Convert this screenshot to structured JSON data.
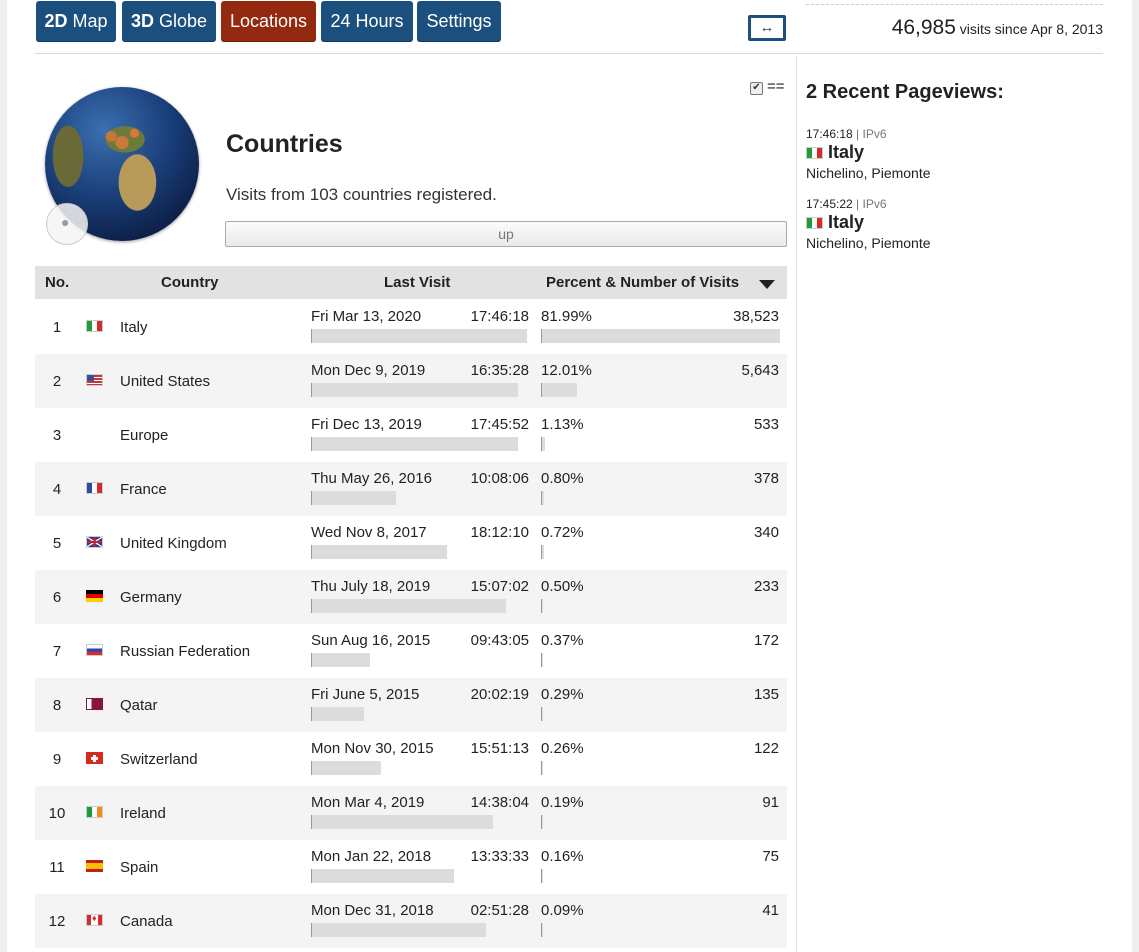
{
  "tabs": [
    {
      "label_bold": "2D",
      "label": " Map",
      "active": false
    },
    {
      "label_bold": "3D",
      "label": " Globe",
      "active": false
    },
    {
      "label_bold": "",
      "label": "Locations",
      "active": true
    },
    {
      "label_bold": "",
      "label": "24 Hours",
      "active": false
    },
    {
      "label_bold": "",
      "label": "Settings",
      "active": false
    }
  ],
  "toggle_icon": "↔",
  "visits_summary": {
    "count": "46,985",
    "text": " visits since Apr 8, 2013"
  },
  "countries_panel": {
    "title": "Countries",
    "subtitle": "Visits from 103 countries registered.",
    "up_label": "up",
    "options_check": "✔",
    "options_equals": "=="
  },
  "table": {
    "headers": {
      "no": "No.",
      "country": "Country",
      "last_visit": "Last Visit",
      "visits": "Percent & Number of Visits"
    },
    "rows": [
      {
        "no": "1",
        "flag": "it",
        "country": "Italy",
        "date": "Fri Mar 13, 2020",
        "time": "17:46:18",
        "last_visit_recency": 1.0,
        "percent": "81.99%",
        "count": "38,523",
        "share": 0.8199
      },
      {
        "no": "2",
        "flag": "us",
        "country": "United States",
        "date": "Mon Dec 9, 2019",
        "time": "16:35:28",
        "last_visit_recency": 0.96,
        "percent": "12.01%",
        "count": "5,643",
        "share": 0.1201
      },
      {
        "no": "3",
        "flag": "none",
        "country": "Europe",
        "date": "Fri Dec 13, 2019",
        "time": "17:45:52",
        "last_visit_recency": 0.96,
        "percent": "1.13%",
        "count": "533",
        "share": 0.0113
      },
      {
        "no": "4",
        "flag": "fr",
        "country": "France",
        "date": "Thu May 26, 2016",
        "time": "10:08:06",
        "last_visit_recency": 0.39,
        "percent": "0.80%",
        "count": "378",
        "share": 0.008
      },
      {
        "no": "5",
        "flag": "gb",
        "country": "United Kingdom",
        "date": "Wed Nov 8, 2017",
        "time": "18:12:10",
        "last_visit_recency": 0.63,
        "percent": "0.72%",
        "count": "340",
        "share": 0.0072
      },
      {
        "no": "6",
        "flag": "de",
        "country": "Germany",
        "date": "Thu July 18, 2019",
        "time": "15:07:02",
        "last_visit_recency": 0.9,
        "percent": "0.50%",
        "count": "233",
        "share": 0.005
      },
      {
        "no": "7",
        "flag": "ru",
        "country": "Russian Federation",
        "date": "Sun Aug 16, 2015",
        "time": "09:43:05",
        "last_visit_recency": 0.27,
        "percent": "0.37%",
        "count": "172",
        "share": 0.0037
      },
      {
        "no": "8",
        "flag": "qa",
        "country": "Qatar",
        "date": "Fri June 5, 2015",
        "time": "20:02:19",
        "last_visit_recency": 0.24,
        "percent": "0.29%",
        "count": "135",
        "share": 0.0029
      },
      {
        "no": "9",
        "flag": "ch",
        "country": "Switzerland",
        "date": "Mon Nov 30, 2015",
        "time": "15:51:13",
        "last_visit_recency": 0.32,
        "percent": "0.26%",
        "count": "122",
        "share": 0.0026
      },
      {
        "no": "10",
        "flag": "ie",
        "country": "Ireland",
        "date": "Mon Mar 4, 2019",
        "time": "14:38:04",
        "last_visit_recency": 0.84,
        "percent": "0.19%",
        "count": "91",
        "share": 0.0019
      },
      {
        "no": "11",
        "flag": "es",
        "country": "Spain",
        "date": "Mon Jan 22, 2018",
        "time": "13:33:33",
        "last_visit_recency": 0.66,
        "percent": "0.16%",
        "count": "75",
        "share": 0.0016
      },
      {
        "no": "12",
        "flag": "ca",
        "country": "Canada",
        "date": "Mon Dec 31, 2018",
        "time": "02:51:28",
        "last_visit_recency": 0.81,
        "percent": "0.09%",
        "count": "41",
        "share": 0.0009
      }
    ]
  },
  "sidebar": {
    "title": "2 Recent Pageviews:",
    "pageviews": [
      {
        "time": "17:46:18",
        "sep": " | ",
        "ip": "IPv6",
        "flag": "it",
        "country": "Italy",
        "city": "Nichelino, Piemonte"
      },
      {
        "time": "17:45:22",
        "sep": " | ",
        "ip": "IPv6",
        "flag": "it",
        "country": "Italy",
        "city": "Nichelino, Piemonte"
      }
    ]
  },
  "colors": {
    "tab": "#1b4f7d",
    "tab_active": "#93290e",
    "bar": "#dcdcdc"
  }
}
